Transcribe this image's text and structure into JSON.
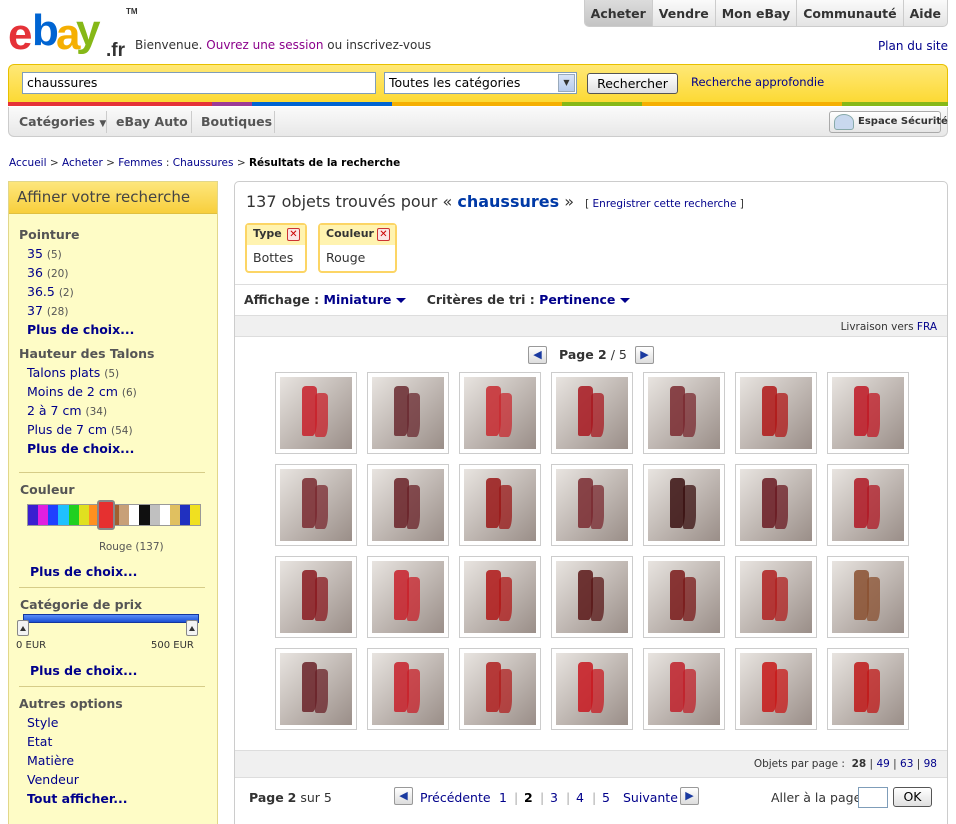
{
  "logo": {
    "letters": [
      "e",
      "b",
      "a",
      "y"
    ],
    "suffix": ".fr",
    "tm": "TM"
  },
  "header": {
    "welcome": "Bienvenue.",
    "signin": "Ouvrez une session",
    "register": "ou inscrivez-vous",
    "site_map": "Plan du site",
    "nav": [
      "Acheter",
      "Vendre",
      "Mon eBay",
      "Communauté",
      "Aide"
    ]
  },
  "search": {
    "query": "chaussures",
    "category": "Toutes les catégories",
    "button": "Rechercher",
    "advanced": "Recherche approfondie"
  },
  "colorstrip": [
    "#e53238",
    "#e53238",
    "#9b3b96",
    "#0064d2",
    "#0064d2",
    "#f5af02",
    "#f5af02",
    "#86b817",
    "#f5af02",
    "#86b817"
  ],
  "catbar": {
    "categories": "Catégories",
    "auto": "eBay Auto",
    "shops": "Boutiques",
    "security": "Espace Sécurité"
  },
  "breadcrumb": {
    "items": [
      "Accueil",
      "Acheter",
      "Femmes",
      "Chaussures"
    ],
    "current": "Résultats de la recherche"
  },
  "sidebar": {
    "title": "Affiner votre recherche",
    "pointure": {
      "title": "Pointure",
      "items": [
        {
          "label": "35",
          "count": "(5)"
        },
        {
          "label": "36",
          "count": "(20)"
        },
        {
          "label": "36.5",
          "count": "(2)"
        },
        {
          "label": "37",
          "count": "(28)"
        }
      ],
      "more": "Plus de choix..."
    },
    "talons": {
      "title": "Hauteur des Talons",
      "items": [
        {
          "label": "Talons plats",
          "count": "(5)"
        },
        {
          "label": "Moins de 2 cm",
          "count": "(6)"
        },
        {
          "label": "2 à 7 cm",
          "count": "(34)"
        },
        {
          "label": "Plus de 7 cm",
          "count": "(54)"
        }
      ],
      "more": "Plus de choix..."
    },
    "couleur": {
      "title": "Couleur",
      "selected": "Rouge (137)",
      "more": "Plus de choix...",
      "swatches": [
        "#3a1fd0",
        "#e020e0",
        "#2040ff",
        "#20c0ff",
        "#20d020",
        "#e0e020",
        "#ff9020",
        "#ff2020",
        "#a06030",
        "#c8a078",
        "#ffffff",
        "#101010",
        "#c0c0c0",
        "#ffffff",
        "#e0c060",
        "#2030c0",
        "#f0e020"
      ]
    },
    "prix": {
      "title": "Catégorie de prix",
      "min": "0 EUR",
      "max": "500 EUR",
      "more": "Plus de choix..."
    },
    "autres": {
      "title": "Autres options",
      "items": [
        "Style",
        "Etat",
        "Matière",
        "Vendeur"
      ],
      "more": "Tout afficher..."
    }
  },
  "results": {
    "count_text": "137 objets trouvés pour «",
    "query": "chaussures",
    "close": "»",
    "save": "Enregistrer cette recherche",
    "filters": [
      {
        "label": "Type",
        "value": "Bottes"
      },
      {
        "label": "Couleur",
        "value": "Rouge"
      }
    ],
    "display_label": "Affichage :",
    "display_value": "Miniature",
    "sort_label": "Critères de tri :",
    "sort_value": "Pertinence",
    "ship_label": "Livraison vers",
    "ship_value": "FRA",
    "page_label": "Page",
    "page_current": "2",
    "page_total": "/ 5",
    "per_page_label": "Objets par page :",
    "per_page": [
      "28",
      "49",
      "63",
      "98"
    ],
    "footer_page": "Page",
    "footer_page_num": "2",
    "footer_of": "sur 5",
    "prev": "Précédente",
    "next": "Suivante",
    "pages": [
      "1",
      "2",
      "3",
      "4",
      "5"
    ],
    "goto_label": "Aller à la page",
    "ok": "OK"
  },
  "thumbnails": [
    "#c8202a",
    "#6a2a30",
    "#c82a30",
    "#a81820",
    "#7a2a30",
    "#b01818",
    "#c01824",
    "#7a2a30",
    "#6a2228",
    "#9a1818",
    "#7a2a30",
    "#3a1010",
    "#6a1a22",
    "#b01824",
    "#8a1a20",
    "#c8202a",
    "#b01818",
    "#5a1818",
    "#7a1a1a",
    "#b02020",
    "#8a5030",
    "#6a2228",
    "#c8202a",
    "#b02020",
    "#c81820",
    "#c0202a",
    "#c81818",
    "#c01818"
  ]
}
